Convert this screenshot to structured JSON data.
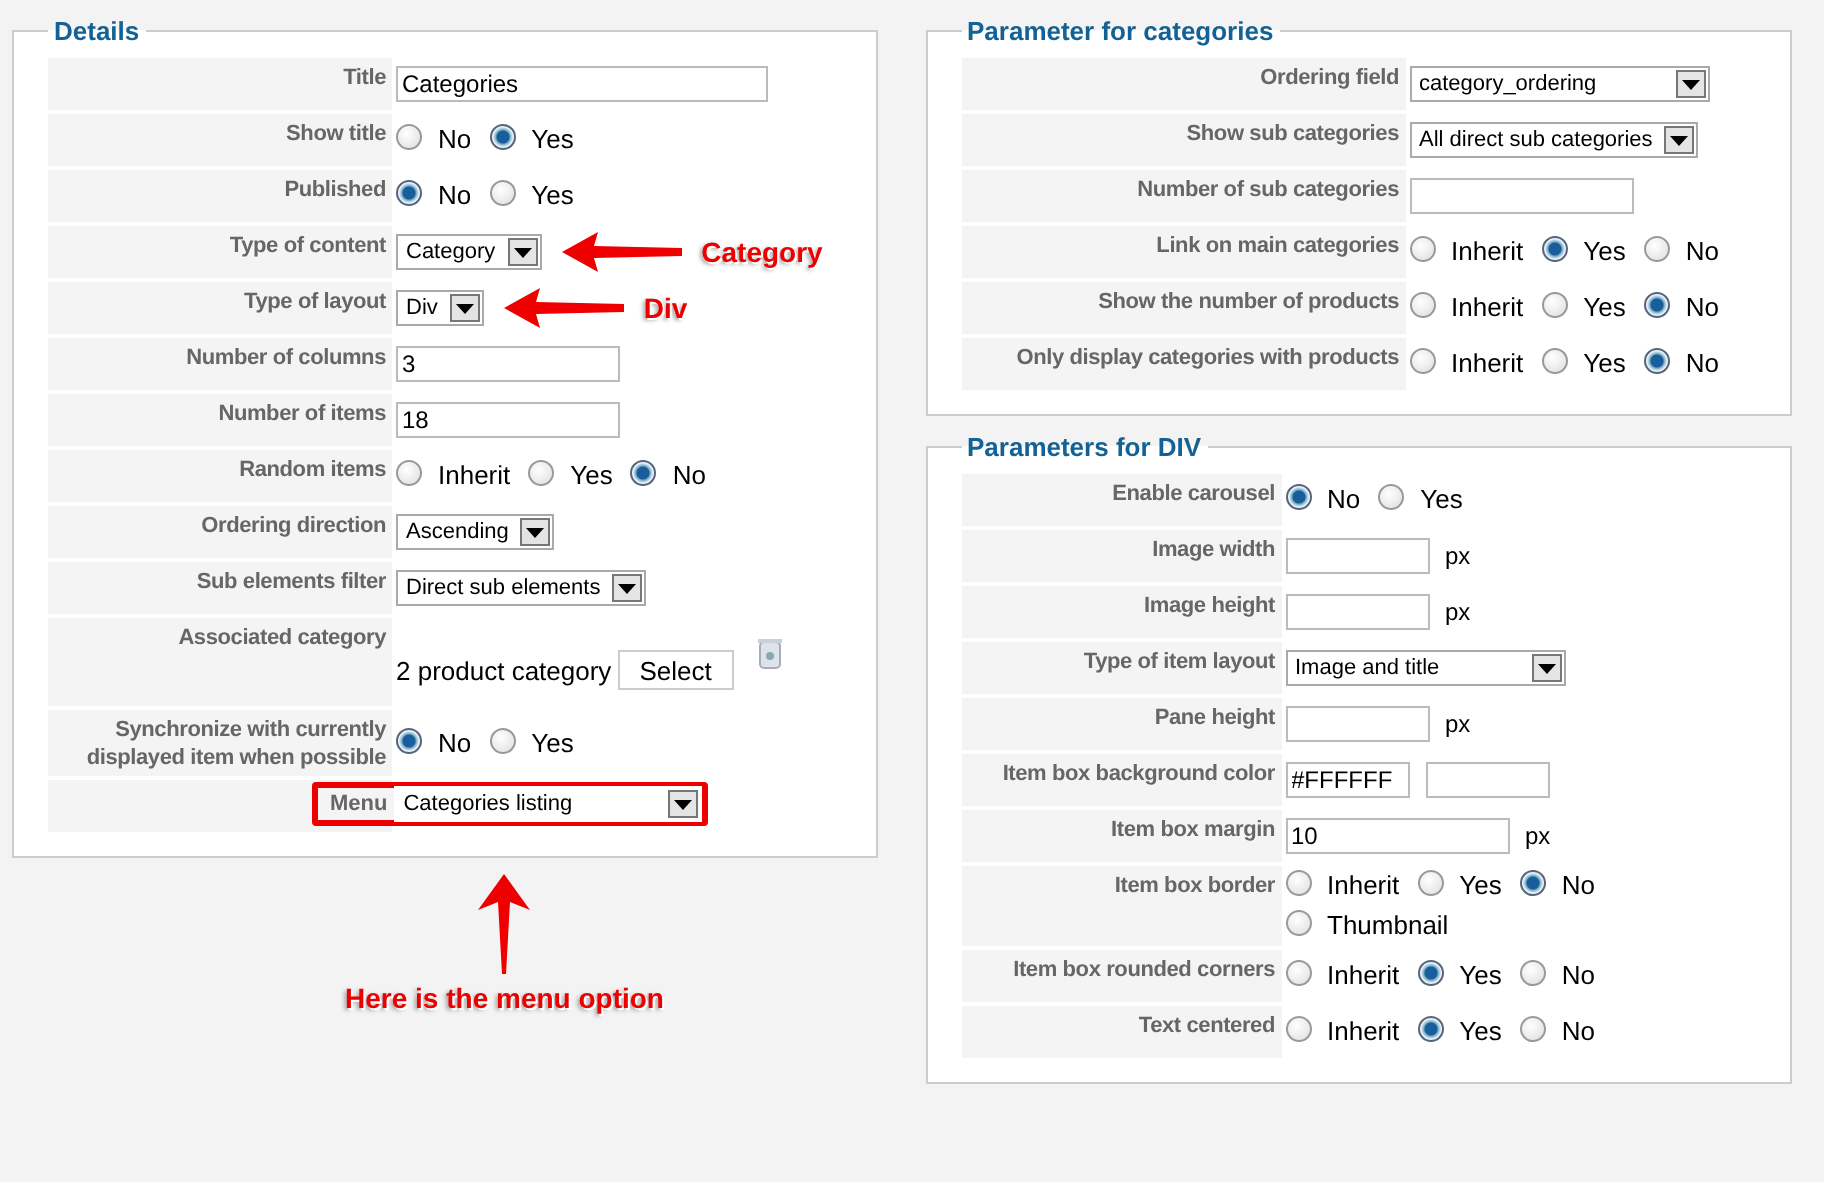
{
  "columns": [
    [
      {
        "title": "Details",
        "rows": [
          {
            "kind": "text",
            "label": "Title",
            "value": "Categories"
          },
          {
            "kind": "radio",
            "label": "Show title",
            "options": [
              {
                "label": "No",
                "selected": false
              },
              {
                "label": "Yes",
                "selected": true
              }
            ]
          },
          {
            "kind": "radio",
            "label": "Published",
            "options": [
              {
                "label": "No",
                "selected": true
              },
              {
                "label": "Yes",
                "selected": false
              }
            ]
          },
          {
            "kind": "select",
            "label": "Type of content",
            "value": "Category",
            "callout": "Category"
          },
          {
            "kind": "select",
            "label": "Type of layout",
            "value": "Div",
            "callout": "Div"
          },
          {
            "kind": "text",
            "label": "Number of columns",
            "value": "3"
          },
          {
            "kind": "text",
            "label": "Number of items",
            "value": "18"
          },
          {
            "kind": "radio",
            "label": "Random items",
            "options": [
              {
                "label": "Inherit",
                "selected": false
              },
              {
                "label": "Yes",
                "selected": false
              },
              {
                "label": "No",
                "selected": true
              }
            ]
          },
          {
            "kind": "select",
            "label": "Ordering direction",
            "value": "Ascending"
          },
          {
            "kind": "select",
            "label": "Sub elements filter",
            "value": "Direct sub elements"
          },
          {
            "kind": "category",
            "label": "Associated category",
            "value": "2 product category",
            "button": "Select"
          },
          {
            "kind": "radio",
            "label": "Synchronize with currently displayed item when possible",
            "options": [
              {
                "label": "No",
                "selected": true
              },
              {
                "label": "Yes",
                "selected": false
              }
            ]
          },
          {
            "kind": "select",
            "label": "Menu",
            "value": "Categories listing",
            "highlighted": true
          }
        ],
        "note": "Here is the menu option"
      }
    ],
    [
      {
        "title": "Parameter for categories",
        "rows": [
          {
            "kind": "select",
            "label": "Ordering field",
            "value": "category_ordering"
          },
          {
            "kind": "select",
            "label": "Show sub categories",
            "value": "All direct sub categories"
          },
          {
            "kind": "text",
            "label": "Number of sub categories"
          },
          {
            "kind": "radio",
            "label": "Link on main categories",
            "options": [
              {
                "label": "Inherit",
                "selected": false
              },
              {
                "label": "Yes",
                "selected": true
              },
              {
                "label": "No",
                "selected": false
              }
            ]
          },
          {
            "kind": "radio",
            "label": "Show the number of products",
            "options": [
              {
                "label": "Inherit",
                "selected": false
              },
              {
                "label": "Yes",
                "selected": false
              },
              {
                "label": "No",
                "selected": true
              }
            ]
          },
          {
            "kind": "radio",
            "label": "Only display categories with products",
            "options": [
              {
                "label": "Inherit",
                "selected": false
              },
              {
                "label": "Yes",
                "selected": false
              },
              {
                "label": "No",
                "selected": true
              }
            ]
          }
        ]
      },
      {
        "title": "Parameters for DIV",
        "rows": [
          {
            "kind": "radio",
            "label": "Enable carousel",
            "options": [
              {
                "label": "No",
                "selected": true
              },
              {
                "label": "Yes",
                "selected": false
              }
            ]
          },
          {
            "kind": "text",
            "label": "Image width",
            "suffix": "px"
          },
          {
            "kind": "text",
            "label": "Image height",
            "suffix": "px"
          },
          {
            "kind": "select",
            "label": "Type of item layout",
            "value": "Image and title"
          },
          {
            "kind": "text",
            "label": "Pane height",
            "suffix": "px"
          },
          {
            "kind": "color",
            "label": "Item box background color",
            "value": "#FFFFFF"
          },
          {
            "kind": "text",
            "label": "Item box margin",
            "value": "10",
            "suffix": "px"
          },
          {
            "kind": "radio",
            "label": "Item box border",
            "options": [
              {
                "label": "Inherit",
                "selected": false
              },
              {
                "label": "Yes",
                "selected": false
              },
              {
                "label": "No",
                "selected": true
              },
              {
                "label": "Thumbnail",
                "selected": false
              }
            ]
          },
          {
            "kind": "radio",
            "label": "Item box rounded corners",
            "options": [
              {
                "label": "Inherit",
                "selected": false
              },
              {
                "label": "Yes",
                "selected": true
              },
              {
                "label": "No",
                "selected": false
              }
            ]
          },
          {
            "kind": "radio",
            "label": "Text centered",
            "options": [
              {
                "label": "Inherit",
                "selected": false
              },
              {
                "label": "Yes",
                "selected": true
              },
              {
                "label": "No",
                "selected": false
              }
            ]
          }
        ]
      }
    ]
  ]
}
